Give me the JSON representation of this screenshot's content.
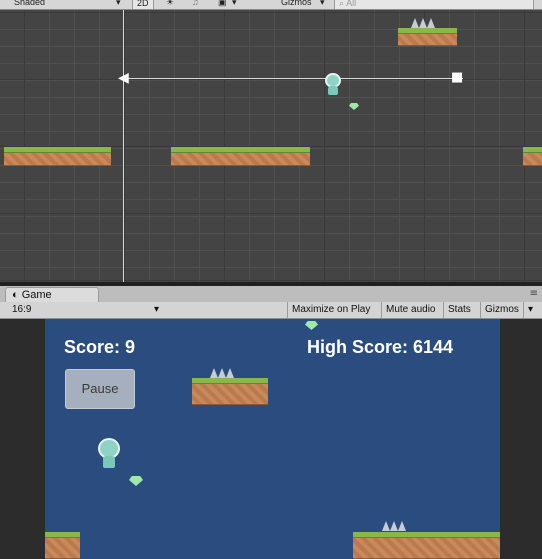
{
  "scene_toolbar": {
    "shading_mode": "Shaded",
    "mode_2d": "2D",
    "gizmos_label": "Gizmos",
    "search_placeholder": "All"
  },
  "game_tab": {
    "label": "Game"
  },
  "game_toolbar": {
    "aspect": "16:9",
    "maximize": "Maximize on Play",
    "mute": "Mute audio",
    "stats": "Stats",
    "gizmos": "Gizmos"
  },
  "game_view": {
    "score_label": "Score: 9",
    "high_score_label": "High Score: 6144",
    "pause_button": "Pause"
  },
  "colors": {
    "scene_bg": "#444444",
    "game_bg": "#2b4c7e",
    "grass": "#8ab64a",
    "dirt": "#c88a5c"
  },
  "icons": [
    "sun-icon",
    "audio-icon",
    "image-icon",
    "speaker-icon",
    "camera-icon",
    "unity-icon"
  ]
}
